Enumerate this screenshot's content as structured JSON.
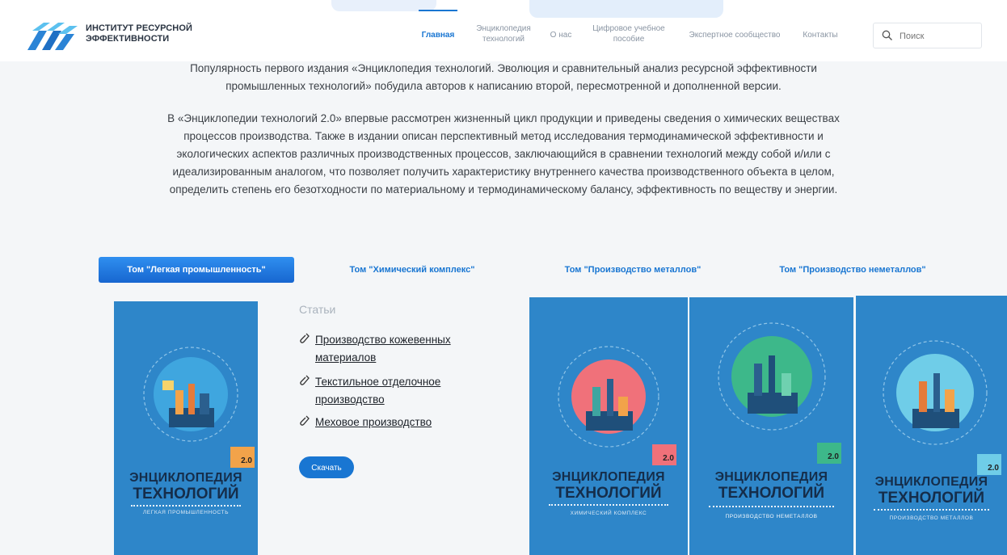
{
  "header": {
    "brand_line1": "ИНСТИТУТ РЕСУРСНОЙ",
    "brand_line2": "ЭФФЕКТИВНОСТИ",
    "nav": [
      {
        "label": "Главная"
      },
      {
        "label_line1": "Энциклопедия",
        "label_line2": "технологий"
      },
      {
        "label": "О нас"
      },
      {
        "label_line1": "Цифровое учебное",
        "label_line2": "пособие"
      },
      {
        "label": "Экспертное сообщество"
      },
      {
        "label": "Контакты"
      }
    ],
    "search_placeholder": "Поиск"
  },
  "intro": {
    "p1_line1": "Популярность первого издания «Энциклопедия технологий. Эволюция и сравнительный анализ ресурсной эффективности",
    "p1_line2": "промышленных технологий» побудила авторов к написанию второй, пересмотренной и дополненной версии.",
    "p2": [
      "В «Энциклопедии технологий 2.0» впервые рассмотрен жизненный цикл продукции и приведены сведения о химических веществах",
      "процессов производства. Также в издании описан перспективный метод исследования термодинамической эффективности и",
      "экологических аспектов различных производственных процессов, заключающийся в сравнении технологий между собой и/или с",
      "идеализированным аналогом, что позволяет получить характеристику внутреннего качества производственного объекта в целом,",
      "определить степень его безотходности по материальному и термодинамическому балансу, эффективность по веществу и энергии."
    ]
  },
  "tabs": [
    {
      "label": "Том \"Легкая промышленность\"",
      "active": true
    },
    {
      "label": "Том \"Химический комплекс\""
    },
    {
      "label": "Том \"Производство металлов\""
    },
    {
      "label": "Том \"Производство неметаллов\""
    }
  ],
  "articles": {
    "title": "Статьи",
    "items": [
      {
        "label": "Производство кожевенных материалов"
      },
      {
        "label": "Текстильное отделочное производство"
      },
      {
        "label": "Меховое производство"
      }
    ],
    "download_label": "Скачать"
  },
  "covers": [
    {
      "title1": "ЭНЦИКЛОПЕДИЯ",
      "title2": "ТЕХНОЛОГИЙ",
      "edition": "2.0",
      "subtitle": "ЛЕГКАЯ ПРОМЫШЛЕННОСТЬ",
      "circle_color": "#3fa6df",
      "badge_color": "#f2a34a"
    },
    {
      "title1": "ЭНЦИКЛОПЕДИЯ",
      "title2": "ТЕХНОЛОГИЙ",
      "edition": "2.0",
      "subtitle": "ХИМИЧЕСКИЙ КОМПЛЕКС",
      "circle_color": "#f0717a",
      "badge_color": "#f0717a"
    },
    {
      "title1": "ЭНЦИКЛОПЕДИЯ",
      "title2": "ТЕХНОЛОГИЙ",
      "edition": "2.0",
      "subtitle": "ПРОИЗВОДСТВО НЕМЕТАЛЛОВ",
      "circle_color": "#3db88a",
      "badge_color": "#3db88a"
    },
    {
      "title1": "ЭНЦИКЛОПЕДИЯ",
      "title2": "ТЕХНОЛОГИЙ",
      "edition": "2.0",
      "subtitle": "ПРОИЗВОДСТВО МЕТАЛЛОВ",
      "circle_color": "#6fcde8",
      "badge_color": "#6fcde8"
    }
  ],
  "colors": {
    "accent": "#1976d2",
    "cover_bg": "#2e86c9"
  }
}
